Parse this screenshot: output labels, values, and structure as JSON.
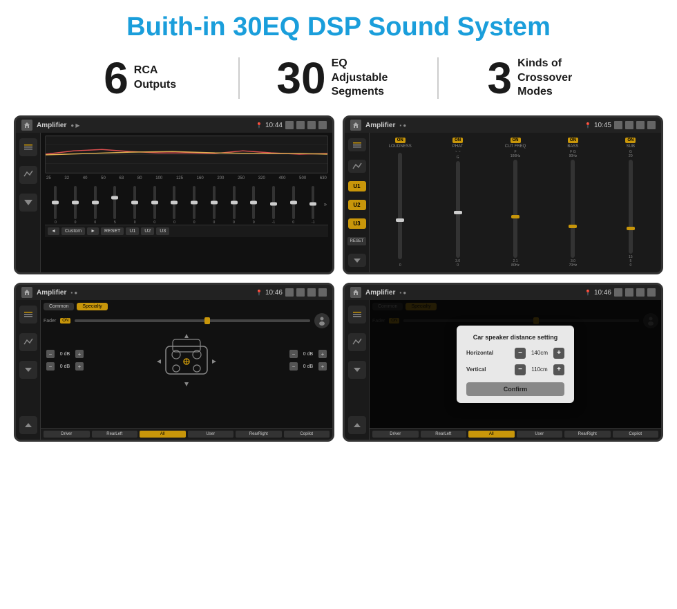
{
  "page": {
    "title": "Buith-in 30EQ DSP Sound System",
    "stats": [
      {
        "number": "6",
        "text": "RCA\nOutputs"
      },
      {
        "number": "30",
        "text": "EQ Adjustable\nSegments"
      },
      {
        "number": "3",
        "text": "Kinds of\nCrossover Modes"
      }
    ]
  },
  "screens": [
    {
      "id": "screen1",
      "status_bar": {
        "app": "Amplifier",
        "time": "10:44"
      },
      "type": "eq",
      "freq_labels": [
        "25",
        "32",
        "40",
        "50",
        "63",
        "80",
        "100",
        "125",
        "160",
        "200",
        "250",
        "320",
        "400",
        "500",
        "630"
      ],
      "slider_values": [
        "0",
        "0",
        "0",
        "5",
        "0",
        "0",
        "0",
        "0",
        "0",
        "0",
        "0",
        "-1",
        "0",
        "-1"
      ],
      "bottom_btns": [
        "◄",
        "Custom",
        "►",
        "RESET",
        "U1",
        "U2",
        "U3"
      ]
    },
    {
      "id": "screen2",
      "status_bar": {
        "app": "Amplifier",
        "time": "10:45"
      },
      "type": "amplifier",
      "u_btns": [
        "U1",
        "U2",
        "U3"
      ],
      "reset_btn": "RESET",
      "amp_cols": [
        {
          "label": "LOUDNESS",
          "on": true
        },
        {
          "label": "PHAT",
          "on": true
        },
        {
          "label": "CUT FREQ",
          "on": true
        },
        {
          "label": "BASS",
          "on": true
        },
        {
          "label": "SUB",
          "on": true
        }
      ]
    },
    {
      "id": "screen3",
      "status_bar": {
        "app": "Amplifier",
        "time": "10:46"
      },
      "type": "speaker",
      "tabs": [
        "Common",
        "Specialty"
      ],
      "fader_label": "Fader",
      "fader_on": "ON",
      "db_rows": [
        {
          "value": "0 dB"
        },
        {
          "value": "0 dB"
        },
        {
          "value": "0 dB"
        },
        {
          "value": "0 dB"
        }
      ],
      "bottom_btns": [
        "Driver",
        "RearLeft",
        "All",
        "User",
        "RearRight",
        "Copilot"
      ]
    },
    {
      "id": "screen4",
      "status_bar": {
        "app": "Amplifier",
        "time": "10:46"
      },
      "type": "dialog",
      "tabs": [
        "Common",
        "Specialty"
      ],
      "dialog": {
        "title": "Car speaker distance setting",
        "rows": [
          {
            "label": "Horizontal",
            "value": "140cm"
          },
          {
            "label": "Vertical",
            "value": "110cm"
          }
        ],
        "confirm_btn": "Confirm"
      },
      "bottom_btns": [
        "Driver",
        "RearLeft",
        "All",
        "User",
        "RearRight",
        "Copilot"
      ]
    }
  ]
}
